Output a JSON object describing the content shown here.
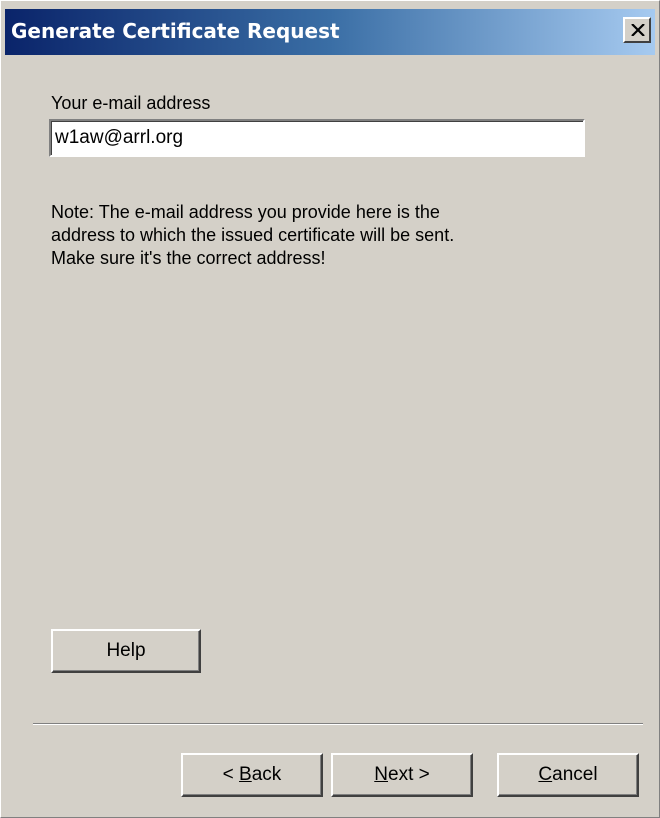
{
  "window": {
    "title": "Generate Certificate Request",
    "close_icon": "close-icon"
  },
  "form": {
    "email_label": "Your e-mail address",
    "email_value": "w1aw@arrl.org"
  },
  "note": {
    "lines": [
      "Note: The e-mail address you provide here is the",
      "address to which the issued certificate will be sent.",
      "Make sure it's the correct address!"
    ]
  },
  "buttons": {
    "help": "Help",
    "back_prefix": "< ",
    "back_mnemonic": "B",
    "back_rest": "ack",
    "next_mnemonic": "N",
    "next_rest": "ext >",
    "cancel_mnemonic": "C",
    "cancel_rest": "ancel"
  },
  "colors": {
    "titlebar_start": "#0a246a",
    "titlebar_end": "#a6caf0",
    "face": "#d4d0c8"
  }
}
